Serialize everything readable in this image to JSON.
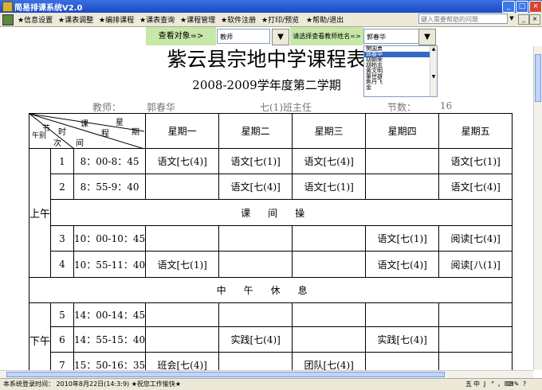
{
  "window": {
    "title": "简易排课系统V2.0",
    "minimize": "_",
    "maximize": "□",
    "close": "×"
  },
  "menu": {
    "items": [
      "★信息设置",
      "★课表调整",
      "★编排课程",
      "★课表查询",
      "★课程管理",
      "★软件注册",
      "★打印/预览",
      "★帮助/退出"
    ],
    "help_placeholder": "键入需要帮助的问题"
  },
  "filter": {
    "query_label": "查看对象=>",
    "query_value": "教师",
    "teacher_label": "请选择查看教师姓名=>",
    "teacher_value": "郭春华",
    "teacher_options": [
      "樊国勇",
      "郭春华",
      "胡朝荣",
      "胡柏志",
      "黄文明",
      "董世雄",
      "焦丹飞",
      "金"
    ],
    "selected_index": 1
  },
  "schedule": {
    "title": "紫云县宗地中学课程表",
    "subtitle": "2008-2009学年度第二学期",
    "teacher_label": "教师：",
    "teacher_name": "郭春华",
    "class_role": "七(1)班主任",
    "periods_label": "节数：",
    "periods_count": "16",
    "header": {
      "h1": "节",
      "h2": "时",
      "h3": "课",
      "h4": "星",
      "h5": "午别",
      "h6": "次",
      "h7": "间",
      "h8": "程",
      "h9": "期"
    },
    "days": [
      "星期一",
      "星期二",
      "星期三",
      "星期四",
      "星期五"
    ],
    "sections": {
      "am": "上午",
      "pm": "下午"
    },
    "banner_morning": "课间操",
    "banner_noon": "中午休息",
    "rows": [
      {
        "n": "1",
        "time": "8：00-8：45",
        "cells": [
          "语文[七(4)]",
          "语文[七(1)]",
          "语文[七(4)]",
          "",
          "语文[七(1)]"
        ]
      },
      {
        "n": "2",
        "time": "8：55-9：40",
        "cells": [
          "",
          "语文[七(4)]",
          "语文[七(1)]",
          "",
          "语文[七(4)]"
        ]
      },
      {
        "n": "3",
        "time": "10：00-10：45",
        "cells": [
          "",
          "",
          "",
          "语文[七(1)]",
          "阅读[七(4)]"
        ]
      },
      {
        "n": "4",
        "time": "10：55-11：40",
        "cells": [
          "语文[七(1)]",
          "",
          "",
          "语文[七(4)]",
          "阅读[八(1)]"
        ]
      },
      {
        "n": "5",
        "time": "14：00-14：45",
        "cells": [
          "",
          "",
          "",
          "",
          ""
        ]
      },
      {
        "n": "6",
        "time": "14：55-15：40",
        "cells": [
          "",
          "实践[七(4)]",
          "",
          "实践[七(4)]",
          ""
        ]
      },
      {
        "n": "7",
        "time": "15：50-16：35",
        "cells": [
          "班会[七(4)]",
          "",
          "团队[七(4)]",
          "",
          ""
        ]
      }
    ]
  },
  "status": {
    "login_text": "本系统登录时间： 2010年8月22日(14:3:9) ★祝您工作愉快★",
    "ime": [
      "五",
      "中",
      "J",
      "°",
      "，",
      "⌨",
      "✎",
      "?"
    ]
  }
}
